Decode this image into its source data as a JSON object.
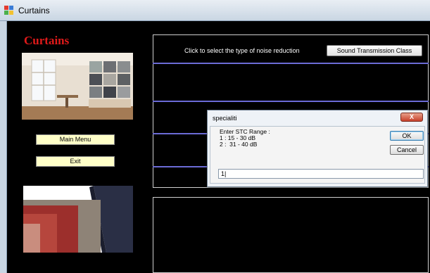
{
  "window": {
    "title": "Curtains"
  },
  "main": {
    "heading": "Curtains",
    "main_menu_label": "Main Menu",
    "exit_label": "Exit",
    "prompt": "Click to select the type of noise reduction",
    "stc_button_label": "Sound Transmission Class"
  },
  "dialog": {
    "title": "specialiti",
    "close_label": "X",
    "message_lines": [
      "Enter STC Range :",
      "1 : 15 - 30 dB",
      "2 :  31 - 40 dB"
    ],
    "ok_label": "OK",
    "cancel_label": "Cancel",
    "input_value": "1|"
  },
  "colors": {
    "heading": "#e01a1a",
    "panel_lines": "#6b6bd6",
    "button_yellow": "#ffffc8"
  }
}
